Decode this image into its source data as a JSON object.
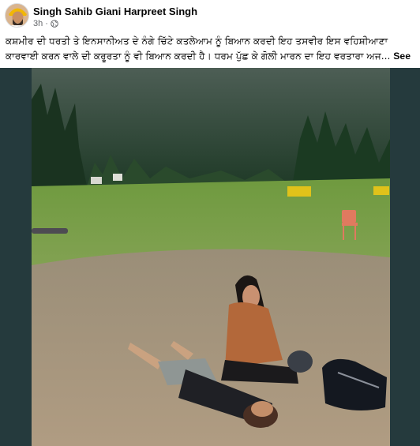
{
  "post": {
    "author": "Singh Sahib Giani Harpreet Singh",
    "time": "3h",
    "dot": "·",
    "audience_icon": "globe-icon",
    "caption": "ਕਸ਼ਮੀਰ ਦੀ ਧਰਤੀ ਤੇ ਇਨਸਾਨੀਅਤ ਦੇ ਨੰਗੇ ਚਿੱਟੇ ਕਤਲੇਆਮ ਨੂੰ ਬਿਆਨ ਕਰਦੀ ਇਹ ਤਸਵੀਰ ਇਸ ਵਹਿਸ਼ੀਆਣਾ ਕਾਰਵਾਈ ਕਰਨ ਵਾਲੇ ਦੀ ਕਰੂਰਤਾ ਨੂੰ ਵੀ ਬਿਆਨ ਕਰਦੀ ਹੈ। ਧਰਮ ਪੁੱਛ ਕੇ ਗੋਲੀ ਮਾਰਨ ਦਾ ਇਹ ਵਰਤਾਰਾ ਅਜ...",
    "see_more": "See more"
  },
  "colors": {
    "media_background": "#253a3d",
    "secondary_text": "#65676b"
  }
}
